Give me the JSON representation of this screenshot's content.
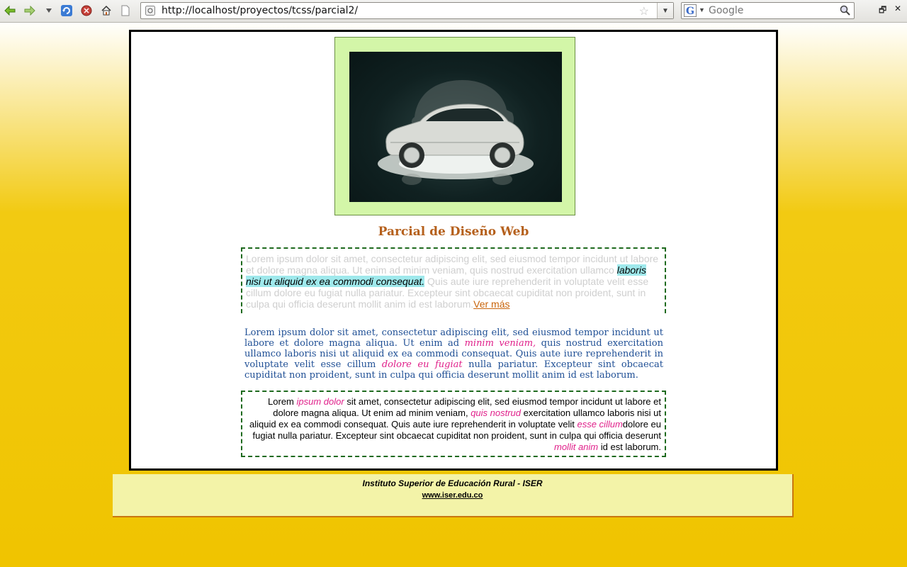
{
  "browser": {
    "url": "http://localhost/proyectos/tcss/parcial2/",
    "search_placeholder": "Google"
  },
  "page": {
    "title": "Parcial de Diseño Web",
    "box1": {
      "text_before": "Lorem ipsum dolor sit amet, consectetur adipiscing elit, sed eiusmod tempor incidunt ut labore et dolore magna aliqua. Ut enim ad minim veniam, quis nostrud exercitation ullamco ",
      "highlight": "laboris nisi ut aliquid ex ea commodi consequat.",
      "text_after": " Quis aute iure reprehenderit in voluptate velit esse cillum dolore eu fugiat nulla pariatur. Excepteur sint obcaecat cupiditat non proident, sunt in culpa qui officia deserunt mollit anim id est laborum.",
      "link": "Ver más"
    },
    "para2": {
      "part1": "Lorem ipsum dolor sit amet, consectetur adipiscing elit, sed eiusmod tempor incidunt ut labore et dolore magna aliqua. Ut enim ad ",
      "em1": "minim veniam,",
      "part2": " quis nostrud exercitation ullamco laboris nisi ut aliquid ex ea commodi consequat. Quis aute iure reprehenderit in voluptate velit esse cillum ",
      "em2": "dolore eu fugiat",
      "part3": " nulla pariatur. Excepteur sint obcaecat cupiditat non proident, sunt in culpa qui officia deserunt mollit anim id est laborum."
    },
    "box3": {
      "part1": "Lorem ",
      "em1": "ipsum dolor",
      "part2": " sit amet, consectetur adipiscing elit, sed eiusmod tempor incidunt ut labore et dolore magna aliqua. Ut enim ad minim veniam, ",
      "em2": "quis nostrud",
      "part3": " exercitation ullamco laboris nisi ut aliquid ex ea commodi consequat. Quis aute iure reprehenderit in voluptate velit ",
      "em3": "esse cillum",
      "part4": "dolore eu fugiat nulla pariatur. Excepteur sint obcaecat cupiditat non proident, sunt in culpa qui officia deserunt ",
      "em4": "mollit anim",
      "part5": " id est laborum."
    },
    "footer": {
      "institution": "Instituto Superior de Educación Rural - ISER",
      "link": "www.iser.edu.co"
    }
  },
  "colors": {
    "title": "#b5601c",
    "accent_pink": "#e0208a",
    "para_blue": "#1f4f95",
    "border_green": "#1e6a1e",
    "photo_frame": "#d3f6a8",
    "footer_bg": "#f3f3a8",
    "page_yellow": "#f0c400"
  },
  "icons": [
    "back-icon",
    "forward-icon",
    "history-dropdown-icon",
    "reload-icon",
    "stop-icon",
    "home-icon",
    "page-icon",
    "site-identity-icon",
    "bookmark-star-icon",
    "search-engine-icon",
    "search-magnifier-icon",
    "restore-window-icon",
    "close-window-icon"
  ]
}
